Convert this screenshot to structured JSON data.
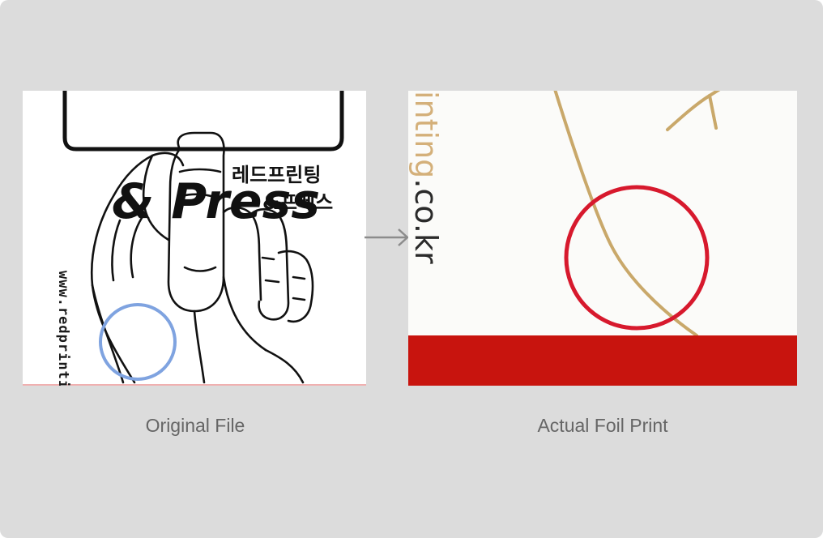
{
  "left_panel": {
    "caption": "Original File",
    "press_text": "& Press",
    "korean_line_1": "레드프린팅",
    "korean_line_2": "&프레스",
    "url_text": "www.redprinting.co.kr",
    "highlight_color": "#7fa3e0"
  },
  "right_panel": {
    "caption": "Actual Foil Print",
    "partial_text_gold": "inting",
    "partial_text_dark": ".co.kr",
    "highlight_color": "#d7192d",
    "strip_color": "#c8140e",
    "foil_color": "#c9a86a"
  },
  "arrow": {
    "icon": "right-arrow-icon",
    "color": "#8c8c8c"
  }
}
